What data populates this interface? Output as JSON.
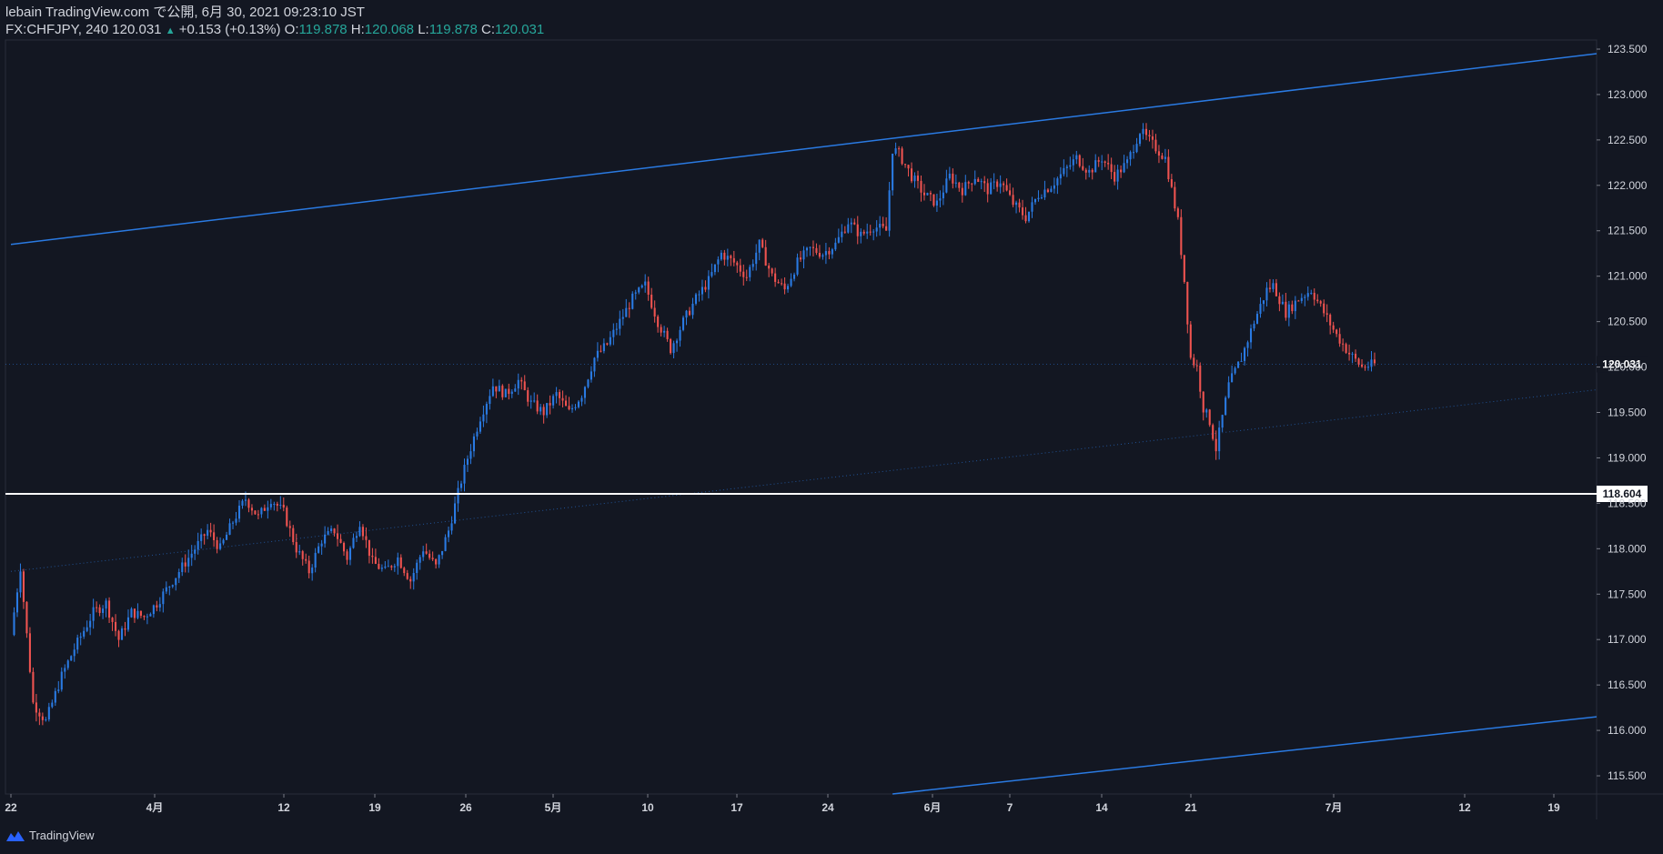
{
  "header": {
    "published_line": "lebain TradingView.com で公開, 6月 30, 2021 09:23:10 JST",
    "symbol_interval": "FX:CHFJPY, 240",
    "last": "120.031",
    "change": "+0.153 (+0.13%)",
    "o_label": "O:",
    "o_value": "119.878",
    "h_label": "H:",
    "h_value": "120.068",
    "l_label": "L:",
    "l_value": "119.878",
    "c_label": "C:",
    "c_value": "120.031"
  },
  "footer": {
    "brand": "TradingView"
  },
  "colors": {
    "background": "#131722",
    "up": "#2a7ae2",
    "down": "#ef5350",
    "channel": "#2a7ae2",
    "hline": "#ffffff",
    "axis": "#787b86"
  },
  "chart_data": {
    "type": "candlestick",
    "symbol": "FX:CHFJPY",
    "interval": "240",
    "ylim": [
      115.3,
      123.6
    ],
    "y_ticks": [
      "115.500",
      "116.000",
      "116.500",
      "117.000",
      "117.500",
      "118.000",
      "118.500",
      "119.000",
      "119.500",
      "120.000",
      "120.500",
      "121.000",
      "121.500",
      "122.000",
      "122.500",
      "123.000",
      "123.500"
    ],
    "x_ticks": [
      {
        "label": "22",
        "x": 0
      },
      {
        "label": "4月",
        "x": 1
      },
      {
        "label": "12",
        "x": 2
      },
      {
        "label": "19",
        "x": 3
      },
      {
        "label": "26",
        "x": 4
      },
      {
        "label": "5月",
        "x": 5
      },
      {
        "label": "10",
        "x": 6
      },
      {
        "label": "17",
        "x": 7
      },
      {
        "label": "24",
        "x": 8
      },
      {
        "label": "6月",
        "x": 9
      },
      {
        "label": "7",
        "x": 10
      },
      {
        "label": "14",
        "x": 11
      },
      {
        "label": "21",
        "x": 12
      },
      {
        "label": "7月",
        "x": 13
      },
      {
        "label": "12",
        "x": 14
      },
      {
        "label": "19",
        "x": 15
      }
    ],
    "price_path": [
      [
        0,
        117.05
      ],
      [
        1.5,
        117.8
      ],
      [
        3.5,
        116.3
      ],
      [
        5.5,
        116.1
      ],
      [
        8,
        116.6
      ],
      [
        10,
        116.9
      ],
      [
        13,
        117.3
      ],
      [
        15,
        117.4
      ],
      [
        17,
        117.0
      ],
      [
        19,
        117.3
      ],
      [
        21,
        117.25
      ],
      [
        23,
        117.4
      ],
      [
        25,
        117.6
      ],
      [
        28,
        117.9
      ],
      [
        31,
        118.2
      ],
      [
        33,
        118.0
      ],
      [
        35,
        118.3
      ],
      [
        37,
        118.55
      ],
      [
        39,
        118.35
      ],
      [
        41,
        118.55
      ],
      [
        43,
        118.4
      ],
      [
        45,
        118.0
      ],
      [
        47,
        117.75
      ],
      [
        49,
        118.1
      ],
      [
        51,
        118.2
      ],
      [
        53,
        117.9
      ],
      [
        55,
        118.3
      ],
      [
        57,
        117.85
      ],
      [
        59,
        117.75
      ],
      [
        61,
        117.9
      ],
      [
        63,
        117.65
      ],
      [
        65,
        118.0
      ],
      [
        67,
        117.8
      ],
      [
        69,
        118.2
      ],
      [
        71,
        118.75
      ],
      [
        72,
        119.0
      ],
      [
        74,
        119.45
      ],
      [
        76,
        119.8
      ],
      [
        78,
        119.7
      ],
      [
        80,
        119.85
      ],
      [
        82,
        119.6
      ],
      [
        84,
        119.5
      ],
      [
        86,
        119.7
      ],
      [
        88,
        119.5
      ],
      [
        90,
        119.7
      ],
      [
        92,
        120.1
      ],
      [
        94,
        120.25
      ],
      [
        96,
        120.5
      ],
      [
        98,
        120.75
      ],
      [
        100,
        120.9
      ],
      [
        102,
        120.5
      ],
      [
        104,
        120.2
      ],
      [
        106,
        120.5
      ],
      [
        108,
        120.75
      ],
      [
        110,
        120.95
      ],
      [
        112,
        121.25
      ],
      [
        114,
        121.15
      ],
      [
        116,
        121.0
      ],
      [
        118,
        121.35
      ],
      [
        120,
        121.0
      ],
      [
        122,
        120.85
      ],
      [
        124,
        121.15
      ],
      [
        126,
        121.3
      ],
      [
        128,
        121.25
      ],
      [
        130,
        121.35
      ],
      [
        132,
        121.6
      ],
      [
        134,
        121.45
      ],
      [
        136,
        121.55
      ],
      [
        138,
        121.5
      ],
      [
        139,
        122.4
      ],
      [
        140,
        122.35
      ],
      [
        142,
        122.1
      ],
      [
        144,
        121.9
      ],
      [
        146,
        121.8
      ],
      [
        148,
        122.1
      ],
      [
        150,
        121.95
      ],
      [
        152,
        122.1
      ],
      [
        154,
        121.95
      ],
      [
        156,
        122.05
      ],
      [
        158,
        121.8
      ],
      [
        160,
        121.65
      ],
      [
        162,
        121.9
      ],
      [
        164,
        122.0
      ],
      [
        166,
        122.15
      ],
      [
        168,
        122.3
      ],
      [
        170,
        122.15
      ],
      [
        172,
        122.3
      ],
      [
        174,
        122.1
      ],
      [
        176,
        122.25
      ],
      [
        178,
        122.6
      ],
      [
        180,
        122.45
      ],
      [
        182,
        122.3
      ],
      [
        183,
        121.95
      ],
      [
        184,
        121.6
      ],
      [
        185,
        120.95
      ],
      [
        186,
        120.1
      ],
      [
        187,
        120.0
      ],
      [
        188,
        119.55
      ],
      [
        189,
        119.4
      ],
      [
        190,
        119.1
      ],
      [
        191,
        119.45
      ],
      [
        192,
        119.8
      ],
      [
        194,
        120.1
      ],
      [
        196,
        120.5
      ],
      [
        198,
        120.85
      ],
      [
        199,
        120.9
      ],
      [
        201,
        120.6
      ],
      [
        203,
        120.75
      ],
      [
        205,
        120.85
      ],
      [
        207,
        120.6
      ],
      [
        209,
        120.35
      ],
      [
        211,
        120.15
      ],
      [
        213,
        120.0
      ],
      [
        215,
        120.031
      ]
    ],
    "channel": {
      "upper": [
        [
          0,
          121.35
        ],
        [
          250,
          123.45
        ]
      ],
      "lower": [
        [
          139,
          115.3
        ],
        [
          250,
          116.15
        ]
      ],
      "mid_dotted": [
        [
          0,
          117.75
        ],
        [
          250,
          119.75
        ]
      ]
    },
    "horizontal_line": {
      "price": 118.604,
      "label": "118.604"
    },
    "last_price": {
      "price": 120.031,
      "label": "120.031"
    }
  }
}
